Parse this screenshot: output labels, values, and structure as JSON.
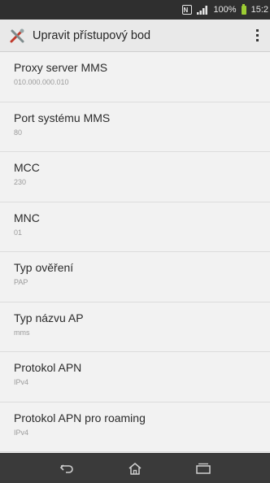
{
  "status_bar": {
    "nfc_icon": "nfc-icon",
    "signal_icon": "signal-icon",
    "battery_percent": "100%",
    "battery_icon": "battery-icon",
    "time": "15:2"
  },
  "action_bar": {
    "app_icon": "tools-icon",
    "title": "Upravit přístupový bod",
    "overflow_icon": "overflow-menu-icon"
  },
  "settings": {
    "items": [
      {
        "title": "Proxy server MMS",
        "value": "010.000.000.010"
      },
      {
        "title": "Port systému MMS",
        "value": "80"
      },
      {
        "title": "MCC",
        "value": "230"
      },
      {
        "title": "MNC",
        "value": "01"
      },
      {
        "title": "Typ ověření",
        "value": "PAP"
      },
      {
        "title": "Typ názvu AP",
        "value": "mms"
      },
      {
        "title": "Protokol APN",
        "value": "IPv4"
      },
      {
        "title": "Protokol APN pro roaming",
        "value": "IPv4"
      }
    ]
  },
  "nav_bar": {
    "back_icon": "back-icon",
    "home_icon": "home-icon",
    "recents_icon": "recent-apps-icon"
  },
  "colors": {
    "status_bar_bg": "#2f2f2f",
    "action_bar_bg": "#e9e9e9",
    "list_bg": "#f2f2f2",
    "nav_bar_bg": "#3a3a3a",
    "battery": "#9ccc33"
  }
}
